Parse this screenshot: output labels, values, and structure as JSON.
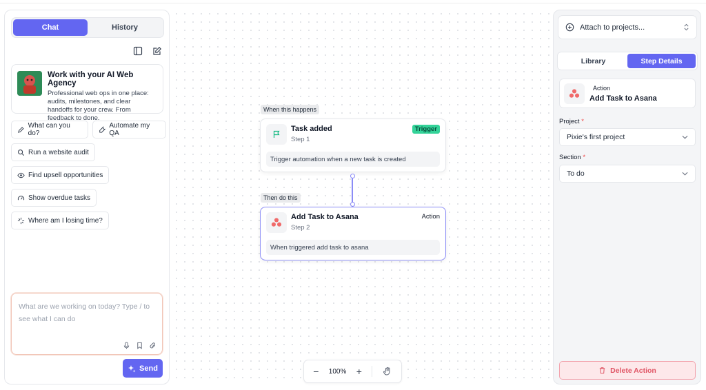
{
  "left_panel": {
    "tabs": [
      {
        "label": "Chat",
        "active": true
      },
      {
        "label": "History",
        "active": false
      }
    ],
    "agency": {
      "title": "Work with your AI Web Agency",
      "description": "Professional web ops in one place: audits, milestones, and clear handoffs for your crew. From feedback to done."
    },
    "chips": [
      {
        "label": "What can you do?",
        "icon": "pencil-icon"
      },
      {
        "label": "Automate my QA",
        "icon": "wrench-icon"
      },
      {
        "label": "Run a website audit",
        "icon": "search-icon"
      },
      {
        "label": "Find upsell opportunities",
        "icon": "eye-icon"
      },
      {
        "label": "Show overdue tasks",
        "icon": "gauge-icon"
      },
      {
        "label": "Where am I losing time?",
        "icon": "sparkle-icon"
      }
    ],
    "composer": {
      "placeholder": "What are we working on today? Type / to see what I can do"
    },
    "send_label": "Send"
  },
  "canvas": {
    "trigger_pill": "When this happens",
    "action_pill": "Then do this",
    "nodes": [
      {
        "title": "Task added",
        "step": "Step 1",
        "badge": "Trigger",
        "description": "Trigger automation when a new task is created"
      },
      {
        "title": "Add Task to Asana",
        "step": "Step 2",
        "badge": "Action",
        "description": "When triggered add task to asana"
      }
    ],
    "zoom": "100%",
    "zoom_out": "−",
    "zoom_in": "+"
  },
  "right_panel": {
    "attach_label": "Attach to projects...",
    "tabs": [
      {
        "label": "Library",
        "active": false
      },
      {
        "label": "Step Details",
        "active": true
      }
    ],
    "step": {
      "type": "Action",
      "name": "Add Task to Asana"
    },
    "project_label": "Project",
    "project_value": "Pixie's first project",
    "section_label": "Section",
    "section_value": "To do",
    "required_mark": "*",
    "delete_label": "Delete Action"
  },
  "colors": {
    "accent": "#6366f1",
    "trigger": "#34d399",
    "asana": "#f06a6a",
    "danger": "#e05565"
  }
}
